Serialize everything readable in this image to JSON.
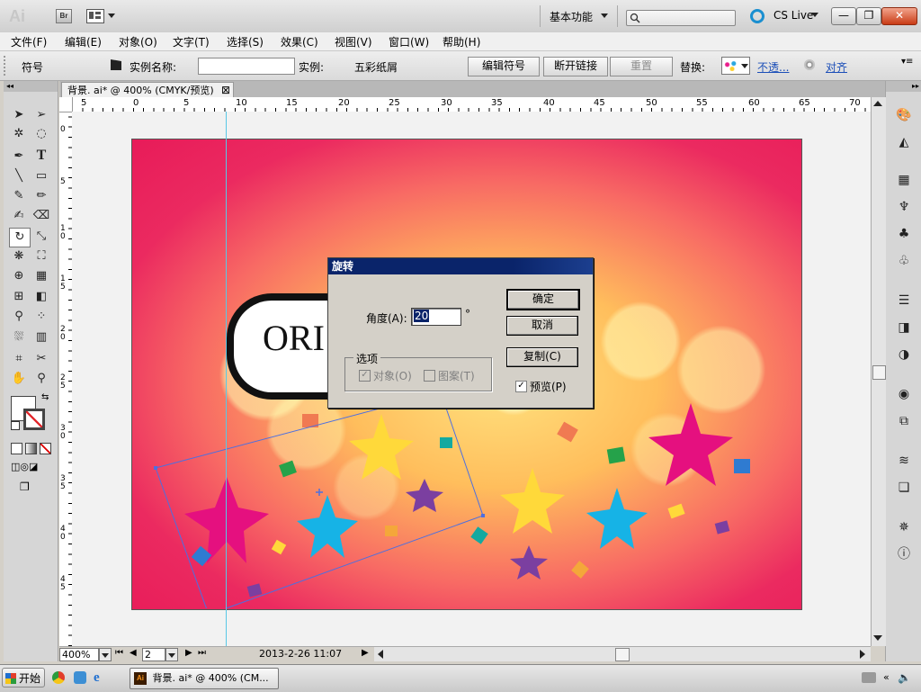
{
  "titlebar": {
    "app_logo": "Ai",
    "bridge_label": "Br",
    "workspace": "基本功能",
    "search_placeholder": "",
    "cslive": "CS Live",
    "min": "—",
    "restore": "❐",
    "close": "✕"
  },
  "menu": [
    "文件(F)",
    "编辑(E)",
    "对象(O)",
    "文字(T)",
    "选择(S)",
    "效果(C)",
    "视图(V)",
    "窗口(W)",
    "帮助(H)"
  ],
  "control": {
    "panel_name": "符号",
    "instance_label": "实例名称:",
    "instance_value": "",
    "instance_of_label": "实例:",
    "instance_of_value": "五彩纸屑",
    "edit_symbol": "编辑符号",
    "break_link": "断开链接",
    "reset": "重置",
    "replace_label": "替换:",
    "opacity_link": "不透...",
    "align_link": "对齐"
  },
  "document": {
    "tab_title": "背景. ai* @ 400% (CMYK/预览)",
    "tab_close": "⊠"
  },
  "ruler": {
    "h_labels": [
      "5",
      "0",
      "5",
      "10",
      "15",
      "20",
      "25",
      "30",
      "35",
      "40",
      "45",
      "50",
      "55",
      "60",
      "65",
      "70"
    ],
    "v_labels": [
      "0",
      "5",
      "1\n0",
      "1\n5",
      "2\n0",
      "2\n5",
      "3\n0",
      "3\n5",
      "4\n0",
      "4\n5"
    ]
  },
  "artwork": {
    "order_text": "ORI"
  },
  "dialog": {
    "title": "旋转",
    "angle_label": "角度(A):",
    "angle_value": "20",
    "degree_symbol": "°",
    "ok": "确定",
    "cancel": "取消",
    "copy": "复制(C)",
    "options_label": "选项",
    "objects_label": "对象(O)",
    "pattern_label": "图案(T)",
    "preview_label": "预览(P)",
    "preview_checked": true
  },
  "status": {
    "zoom": "400%",
    "artboard_number": "2",
    "datetime": "2013-2-26  11:07"
  },
  "taskbar": {
    "start": "开始",
    "task_title": "背景. ai* @ 400% (CM...",
    "task_icon": "Ai"
  }
}
